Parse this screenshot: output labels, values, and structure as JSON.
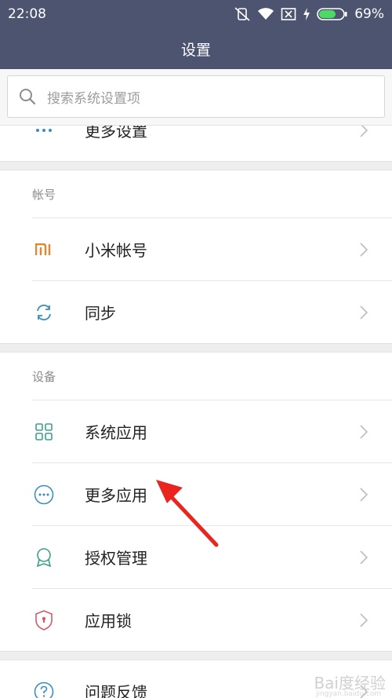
{
  "status_bar": {
    "time": "22:08",
    "battery_percent": "69%",
    "battery_level": 0.69,
    "icons": [
      "vibrate-off-icon",
      "wifi-icon",
      "no-sim-icon",
      "charging-icon",
      "battery-icon"
    ]
  },
  "header": {
    "title": "设置"
  },
  "search": {
    "placeholder": "搜索系统设置项"
  },
  "top_partial": {
    "label": "更多设置",
    "icon": "more-dots-icon"
  },
  "sections": [
    {
      "header": "帐号",
      "items": [
        {
          "label": "小米帐号",
          "icon": "mi-logo-icon"
        },
        {
          "label": "同步",
          "icon": "sync-icon"
        }
      ]
    },
    {
      "header": "设备",
      "items": [
        {
          "label": "系统应用",
          "icon": "grid-apps-icon"
        },
        {
          "label": "更多应用",
          "icon": "more-circle-icon"
        },
        {
          "label": "授权管理",
          "icon": "badge-icon"
        },
        {
          "label": "应用锁",
          "icon": "shield-lock-icon"
        }
      ]
    }
  ],
  "bottom": {
    "label": "问题反馈",
    "icon": "question-icon"
  },
  "colors": {
    "header_bg": "#4d5470",
    "icon_blue": "#3a8dbf",
    "icon_green": "#3ca08a",
    "icon_orange": "#e8822c",
    "icon_red": "#d45a6a",
    "annotation_arrow": "#e8261f"
  },
  "watermark": "Bai度经验",
  "watermark_sub": "jingyan.baidu.com"
}
